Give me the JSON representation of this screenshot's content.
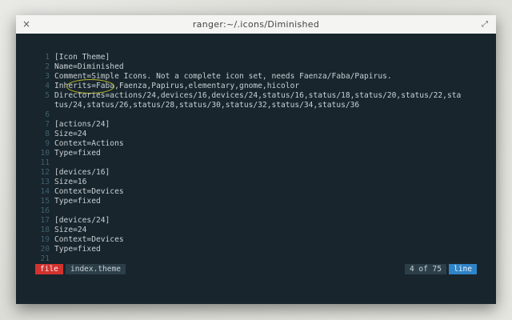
{
  "window": {
    "title": "ranger:~/.icons/Diminished",
    "close_icon": "×",
    "maximize_icon": "⤢"
  },
  "editor": {
    "lines": [
      {
        "num": "1",
        "text": "[Icon Theme]"
      },
      {
        "num": "2",
        "text": "Name=Diminished"
      },
      {
        "num": "3",
        "text": "Comment=Simple Icons. Not a complete icon set, needs Faenza/Faba/Papirus."
      },
      {
        "num": "4",
        "text": "Inherits=Faba,Faenza,Papirus,elementary,gnome,hicolor"
      },
      {
        "num": "5",
        "text": "Directories=actions/24,devices/16,devices/24,status/16,status/18,status/20,status/22,sta"
      },
      {
        "num": "",
        "text": "tus/24,status/26,status/28,status/30,status/32,status/34,status/36"
      },
      {
        "num": "6",
        "text": ""
      },
      {
        "num": "7",
        "text": "[actions/24]"
      },
      {
        "num": "8",
        "text": "Size=24"
      },
      {
        "num": "9",
        "text": "Context=Actions"
      },
      {
        "num": "10",
        "text": "Type=fixed"
      },
      {
        "num": "11",
        "text": ""
      },
      {
        "num": "12",
        "text": "[devices/16]"
      },
      {
        "num": "13",
        "text": "Size=16"
      },
      {
        "num": "14",
        "text": "Context=Devices"
      },
      {
        "num": "15",
        "text": "Type=fixed"
      },
      {
        "num": "16",
        "text": ""
      },
      {
        "num": "17",
        "text": "[devices/24]"
      },
      {
        "num": "18",
        "text": "Size=24"
      },
      {
        "num": "19",
        "text": "Context=Devices"
      },
      {
        "num": "20",
        "text": "Type=fixed"
      },
      {
        "num": "21",
        "text": ""
      }
    ]
  },
  "statusbar": {
    "mode": "file",
    "filename": "index.theme",
    "position": "4 of 75",
    "unit": "line"
  },
  "colors": {
    "background": "#18252d",
    "line_number": "#3f6070",
    "text": "#c8d0d4",
    "mode_badge": "#d3322e",
    "unit_badge": "#2f83c7",
    "highlight_ellipse": "#b8b82a"
  }
}
